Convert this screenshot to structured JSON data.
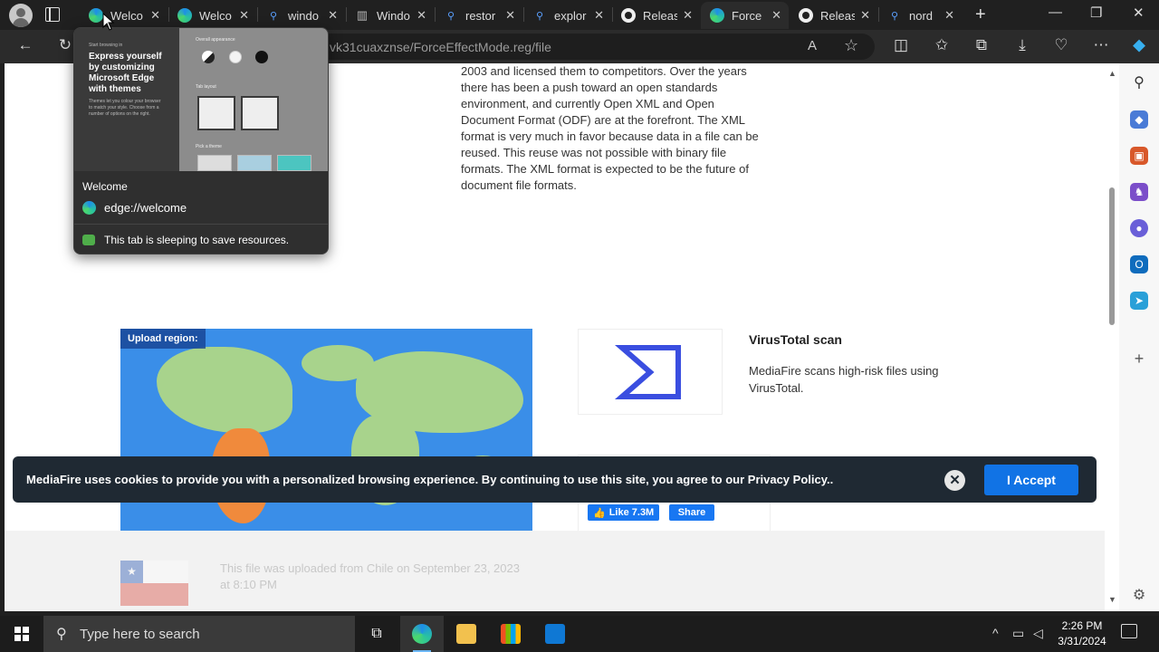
{
  "tabs": [
    {
      "label": "Welco",
      "icon": "edge-icon",
      "active": false
    },
    {
      "label": "Welco",
      "icon": "edge-icon",
      "active": false
    },
    {
      "label": "windo",
      "icon": "search-icon",
      "active": false
    },
    {
      "label": "Windo",
      "icon": "trash-icon",
      "active": false
    },
    {
      "label": "restor",
      "icon": "search-icon",
      "active": false
    },
    {
      "label": "explor",
      "icon": "search-icon",
      "active": false
    },
    {
      "label": "Releas",
      "icon": "github-icon",
      "active": false
    },
    {
      "label": "Force",
      "icon": "edge-icon",
      "active": true
    },
    {
      "label": "Releas",
      "icon": "github-icon",
      "active": false
    },
    {
      "label": "nord",
      "icon": "search-icon",
      "active": false
    }
  ],
  "address": {
    "url": "vk31cuaxznse/ForceEffectMode.reg/file"
  },
  "article": {
    "text": "2003 and licensed them to competitors. Over the years there has been a push toward an open standards environment, and currently Open XML and Open Document Format (ODF) are at the forefront. The XML format is very much in favor because data in a file can be reused. This reuse was not possible with binary file formats. The XML format is expected to be the future of document file formats."
  },
  "map": {
    "label": "Upload region:"
  },
  "virustotal": {
    "title": "VirusTotal scan",
    "description": "MediaFire scans high-risk files using VirusTotal."
  },
  "social": {
    "like": "Like 7.3M",
    "share": "Share"
  },
  "upload_info": {
    "text": "This file was uploaded from Chile on September 23, 2023 at 8:10 PM"
  },
  "cookie": {
    "text": "MediaFire uses cookies to provide you with a personalized browsing experience. By continuing to use this site, you agree to our Privacy Policy..",
    "accept": "I Accept",
    "close": "✕"
  },
  "popover": {
    "preview_heading": "Express yourself by customizing Microsoft Edge with themes",
    "title": "Welcome",
    "url": "edge://welcome",
    "sleep_text": "This tab is sleeping to save resources."
  },
  "taskbar": {
    "search_placeholder": "Type here to search",
    "time": "2:26 PM",
    "date": "3/31/2024"
  },
  "colors": {
    "accent": "#1173e5",
    "map_ocean": "#3a8ee8",
    "map_land": "#a8d38c",
    "map_highlight": "#f08a3c",
    "virustotal": "#3a4ee0"
  }
}
